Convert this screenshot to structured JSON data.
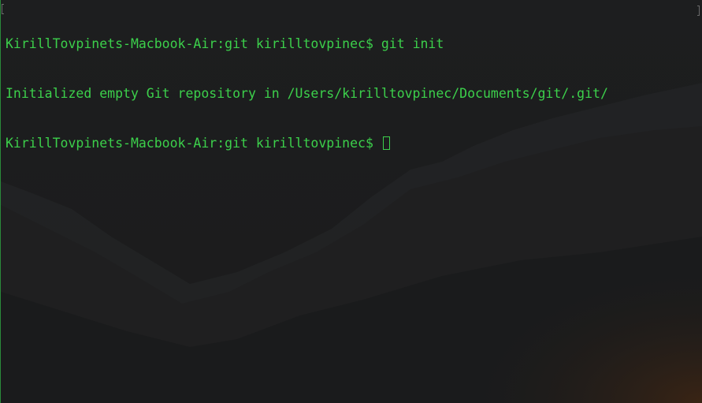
{
  "terminal": {
    "text_color": "#3cd04b",
    "background_color": "#1c1d1e",
    "lines": [
      {
        "prompt": "KirillTovpinets-Macbook-Air:git kirilltovpinec$ ",
        "command": "git init"
      },
      {
        "output": "Initialized empty Git repository in /Users/kirilltovpinec/Documents/git/.git/"
      },
      {
        "prompt": "KirillTovpinets-Macbook-Air:git kirilltovpinec$ ",
        "command": ""
      }
    ]
  }
}
